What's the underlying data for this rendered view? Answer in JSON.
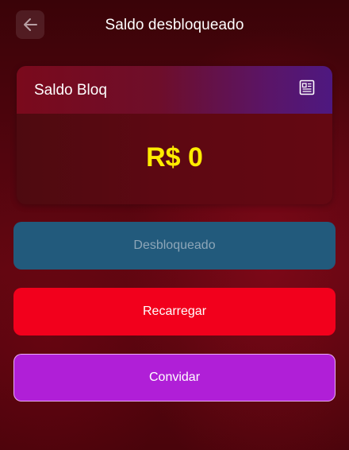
{
  "header": {
    "title": "Saldo desbloqueado",
    "back_icon": "arrow-left-icon"
  },
  "balance_card": {
    "title": "Saldo Bloq",
    "icon": "document-icon",
    "amount": "R$ 0",
    "amount_color": "#ffec00"
  },
  "actions": {
    "unlock_label": "Desbloqueado",
    "recharge_label": "Recarregar",
    "invite_label": "Convidar"
  },
  "colors": {
    "unlock": "#225a7c",
    "recharge": "#f2001c",
    "invite": "#b01fd7"
  }
}
